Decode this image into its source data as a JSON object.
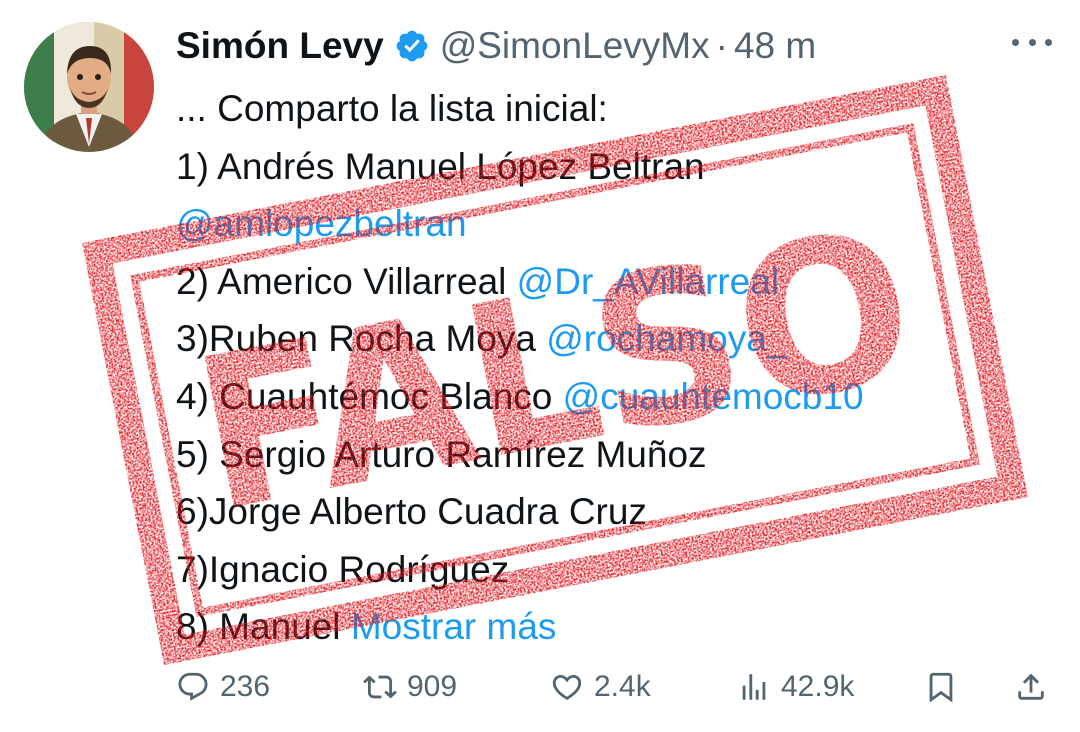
{
  "user": {
    "display_name": "Simón Levy",
    "handle": "@SimonLevyMx",
    "separator": "·",
    "timestamp": "48 m",
    "verified_icon": "verified-badge-icon"
  },
  "tweet": {
    "lines": [
      {
        "text": "... Comparto la lista inicial:",
        "link": ""
      },
      {
        "text": "1) Andrés Manuel López Beltran",
        "link": ""
      },
      {
        "text": "",
        "link": "@amlopezbeltran"
      },
      {
        "text": "2) Americo Villarreal ",
        "link": "@Dr_AVillarreal"
      },
      {
        "text": "3)Ruben Rocha Moya ",
        "link": "@rochamoya_"
      },
      {
        "text": "4) Cuauhtémoc Blanco ",
        "link": "@cuauhtemocb10"
      },
      {
        "text": "5) Sergio Arturo Ramírez Muñoz",
        "link": ""
      },
      {
        "text": "6)Jorge Alberto Cuadra Cruz",
        "link": ""
      },
      {
        "text": "7)Ignacio Rodríguez",
        "link": ""
      },
      {
        "text": "8) Manuel ",
        "link": "Mostrar más"
      }
    ]
  },
  "actions": {
    "replies": "236",
    "retweets": "909",
    "likes": "2.4k",
    "views": "42.9k"
  },
  "stamp": {
    "text": "FALSO",
    "color": "#e1141b"
  },
  "colors": {
    "text": "#0f1419",
    "secondary": "#536471",
    "link": "#1d9bf0",
    "verified": "#1d9bf0"
  }
}
